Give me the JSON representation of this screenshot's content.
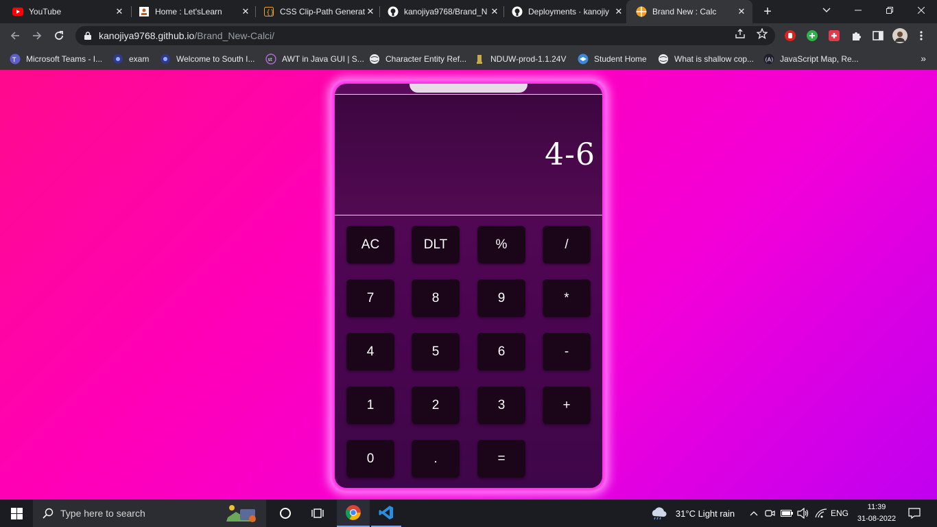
{
  "browser": {
    "tabs": [
      {
        "title": "YouTube",
        "icon": "youtube-icon"
      },
      {
        "title": "Home : Let'sLearn",
        "icon": "letslearn-icon"
      },
      {
        "title": "CSS Clip-Path Generat",
        "icon": "clippy-icon"
      },
      {
        "title": "kanojiya9768/Brand_N",
        "icon": "github-icon"
      },
      {
        "title": "Deployments · kanojiy",
        "icon": "github-icon"
      },
      {
        "title": "Brand New : Calc",
        "icon": "calc-favicon-icon",
        "active": true
      }
    ],
    "address": {
      "host": "kanojiya9768.github.io",
      "path": "/Brand_New-Calci/"
    },
    "bookmarks": [
      {
        "label": "Microsoft Teams - I...",
        "icon": "teams-icon"
      },
      {
        "label": "exam",
        "icon": "teams-icon"
      },
      {
        "label": "Welcome to South I...",
        "icon": "teams-icon"
      },
      {
        "label": "AWT in Java GUI | S...",
        "icon": "st-icon"
      },
      {
        "label": "Character Entity Ref...",
        "icon": "globe-icon"
      },
      {
        "label": "NDUW-prod-1.1.24V",
        "icon": "emblem-icon"
      },
      {
        "label": "Student Home",
        "icon": "student-icon"
      },
      {
        "label": "What is shallow cop...",
        "icon": "globe-icon"
      },
      {
        "label": "JavaScript Map, Re...",
        "icon": "js-icon"
      }
    ]
  },
  "calculator": {
    "display": "4-6",
    "keys": [
      [
        "AC",
        "DLT",
        "%",
        "/"
      ],
      [
        "7",
        "8",
        "9",
        "*"
      ],
      [
        "4",
        "5",
        "6",
        "-"
      ],
      [
        "1",
        "2",
        "3",
        "+"
      ],
      [
        "0",
        ".",
        "="
      ]
    ]
  },
  "taskbar": {
    "search_placeholder": "Type here to search",
    "weather": "31°C  Light rain",
    "language": "ENG",
    "time": "11:39",
    "date": "31-08-2022"
  },
  "colors": {
    "page_gradient_start": "#ff0a8c",
    "page_gradient_end": "#c000f0",
    "phone_frame": "#ff28e8",
    "key_background": "#1b0619"
  }
}
